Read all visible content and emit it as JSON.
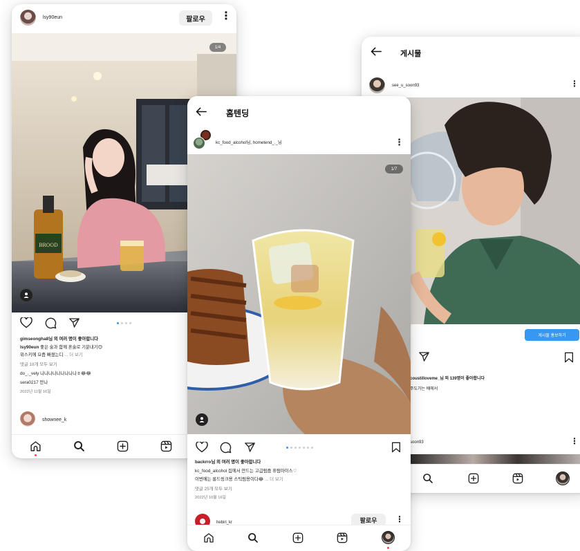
{
  "left": {
    "username": "lsy90eun",
    "follow_label": "팔로우",
    "counter": "1/4",
    "likes_line": "gimseongha8님 외 여러 명이 좋아합니다",
    "caption_user": "lsy90eun",
    "caption_text": "좋은 술과 함께 혼술로 기분내기😊",
    "caption_line2": "위스키에 요즘 빠졌는디",
    "more": "... 더 보기",
    "comments_all": "댓글 18개 모두 보기",
    "comment1_user": "do_._vely",
    "comment1_text": "나나나나나나나나나ㅎ😂😂",
    "comment2_user": "sera0217",
    "comment2_text": "만나",
    "date": "2022년 11월 16일",
    "next_user": "shownee_k"
  },
  "center": {
    "title": "홈텐딩",
    "username": "kc_food_alcohol님, hometend_._님",
    "counter": "1/7",
    "likes_line": "backrro님 외 여러 명이 좋아합니다",
    "caption_user": "kc_food_alcohol",
    "caption_text": "집에서 만드는 고급럼줍 휴럼마이스♡",
    "caption_line2": "이번에는 롱드링크용 스틱럼용이다😂",
    "more": "... 더 보기",
    "comments_all": "댓글 25개 모두 보기",
    "date": "2022년 10월 16일",
    "next_user": "hebiri_kr",
    "follow_label": "팔로우"
  },
  "right": {
    "title": "게시물",
    "username": "see_u_soon93",
    "promote_label": "게시물 홍보하기",
    "likes_line": "coustilloveme_님 외 139명이 좋아합니다",
    "caption_line": "주도가는 배에서",
    "next_user": "soon93"
  },
  "icons": [
    "back-arrow-icon",
    "heart-icon",
    "comment-icon",
    "share-icon",
    "bookmark-icon",
    "home-icon",
    "search-icon",
    "create-icon",
    "reels-icon",
    "more-icon",
    "person-tag-icon"
  ],
  "colors": {
    "accent": "#3897f0",
    "notification": "#ed4956"
  }
}
